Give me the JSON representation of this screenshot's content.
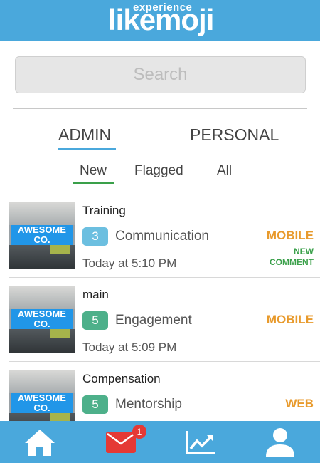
{
  "header": {
    "logo_small": "experience",
    "logo_big": "likemoji",
    "background": "#4aa8dc"
  },
  "search": {
    "placeholder": "Search"
  },
  "scope_tabs": [
    {
      "label": "ADMIN",
      "active": true
    },
    {
      "label": "PERSONAL",
      "active": false
    }
  ],
  "filter_tabs": [
    {
      "label": "New",
      "active": true
    },
    {
      "label": "Flagged",
      "active": false
    },
    {
      "label": "All",
      "active": false
    }
  ],
  "feed": [
    {
      "thumbnail_text": "AWESOME CO.",
      "title": "Training",
      "count": "3",
      "count_color": "#6cbfe0",
      "category": "Communication",
      "time": "Today at 5:10 PM",
      "platform": "MOBILE",
      "status": "NEW COMMENT"
    },
    {
      "thumbnail_text": "AWESOME CO.",
      "title": "main",
      "count": "5",
      "count_color": "#4db08a",
      "category": "Engagement",
      "time": "Today at 5:09 PM",
      "platform": "MOBILE",
      "status": ""
    },
    {
      "thumbnail_text": "AWESOME CO.",
      "title": "Compensation",
      "count": "5",
      "count_color": "#4db08a",
      "category": "Mentorship",
      "time": "",
      "platform": "WEB",
      "status": ""
    }
  ],
  "bottom_nav": {
    "items": [
      {
        "icon": "home-icon"
      },
      {
        "icon": "mail-icon",
        "badge": "1"
      },
      {
        "icon": "chart-icon"
      },
      {
        "icon": "profile-icon"
      }
    ],
    "background": "#4aa8dc",
    "accent": "#e53935"
  }
}
